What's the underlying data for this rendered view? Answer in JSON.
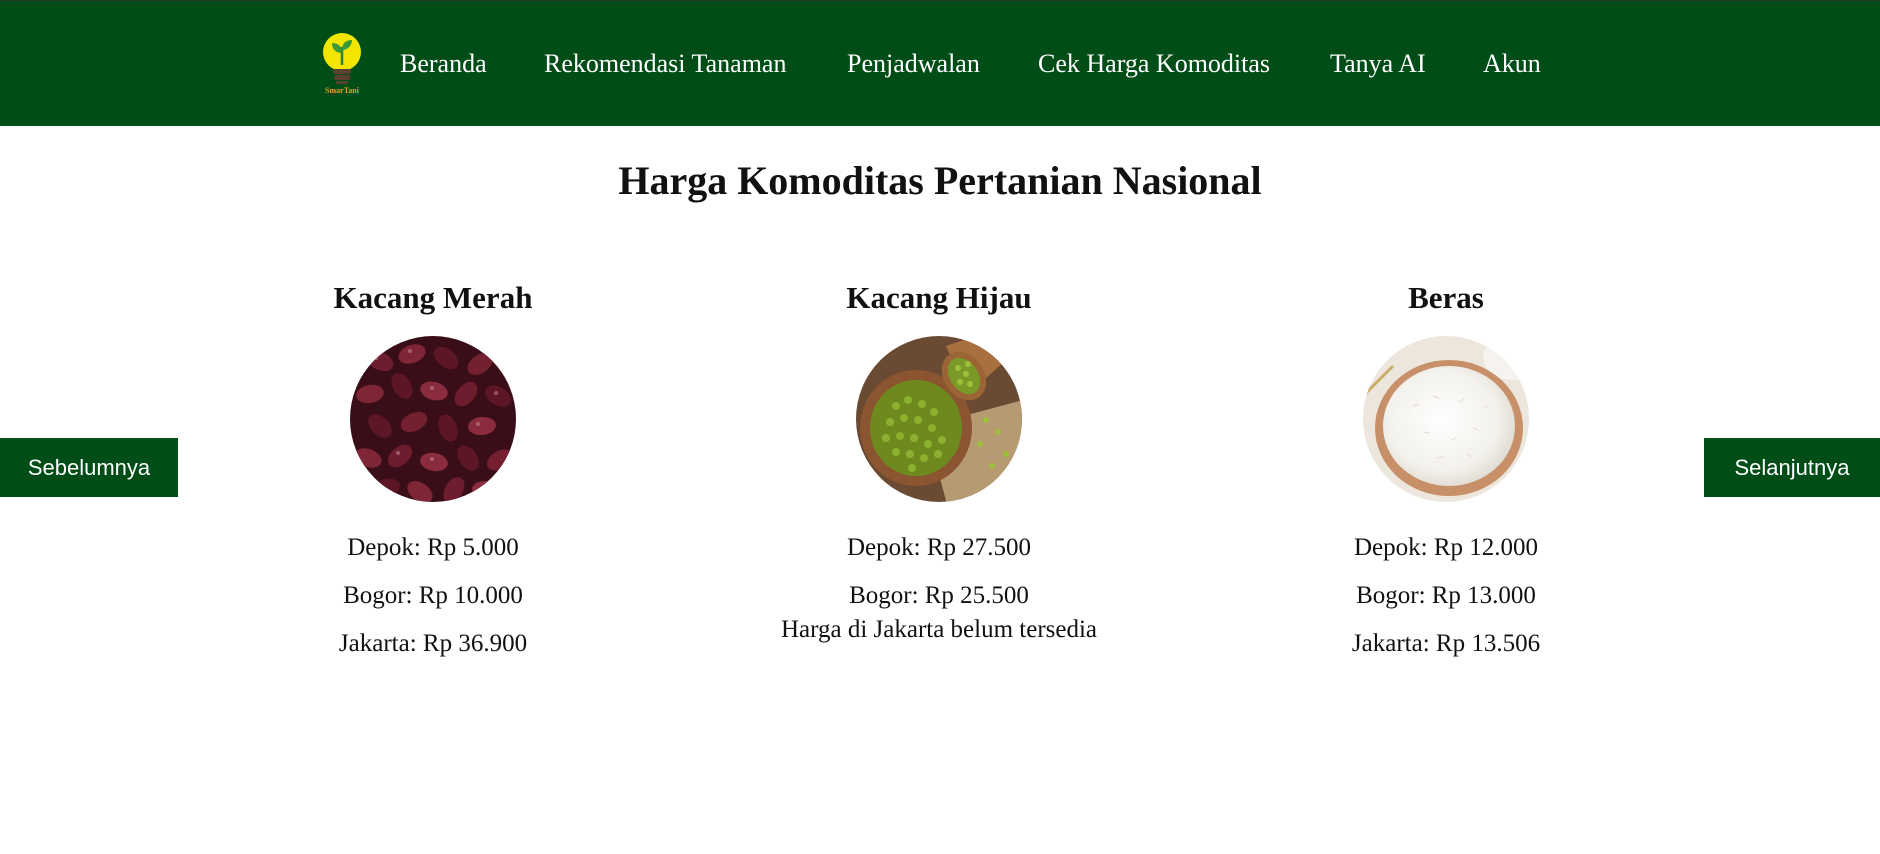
{
  "header": {
    "logo_text": "SmarTani",
    "nav": [
      {
        "label": "Beranda"
      },
      {
        "label": "Rekomendasi Tanaman"
      },
      {
        "label": "Penjadwalan"
      },
      {
        "label": "Cek Harga Komoditas"
      },
      {
        "label": "Tanya AI"
      },
      {
        "label": "Akun"
      }
    ]
  },
  "main": {
    "title": "Harga Komoditas Pertanian Nasional",
    "prev_label": "Sebelumnya",
    "next_label": "Selanjutnya",
    "cards": [
      {
        "name": "Kacang Merah",
        "image_icon": "red-beans-photo",
        "prices": [
          "Depok: Rp 5.000",
          "Bogor: Rp 10.000",
          "Jakarta: Rp 36.900"
        ],
        "note": ""
      },
      {
        "name": "Kacang Hijau",
        "image_icon": "mung-beans-photo",
        "prices": [
          "Depok: Rp 27.500",
          "Bogor: Rp 25.500"
        ],
        "note": "Harga di Jakarta belum tersedia"
      },
      {
        "name": "Beras",
        "image_icon": "rice-photo",
        "prices": [
          "Depok: Rp 12.000",
          "Bogor: Rp 13.000",
          "Jakarta: Rp 13.506"
        ],
        "note": ""
      }
    ]
  },
  "colors": {
    "nav_background": "#004d18",
    "nav_text": "#ffffff",
    "button_background": "#004d18",
    "logo_bulb": "#f2e600"
  }
}
